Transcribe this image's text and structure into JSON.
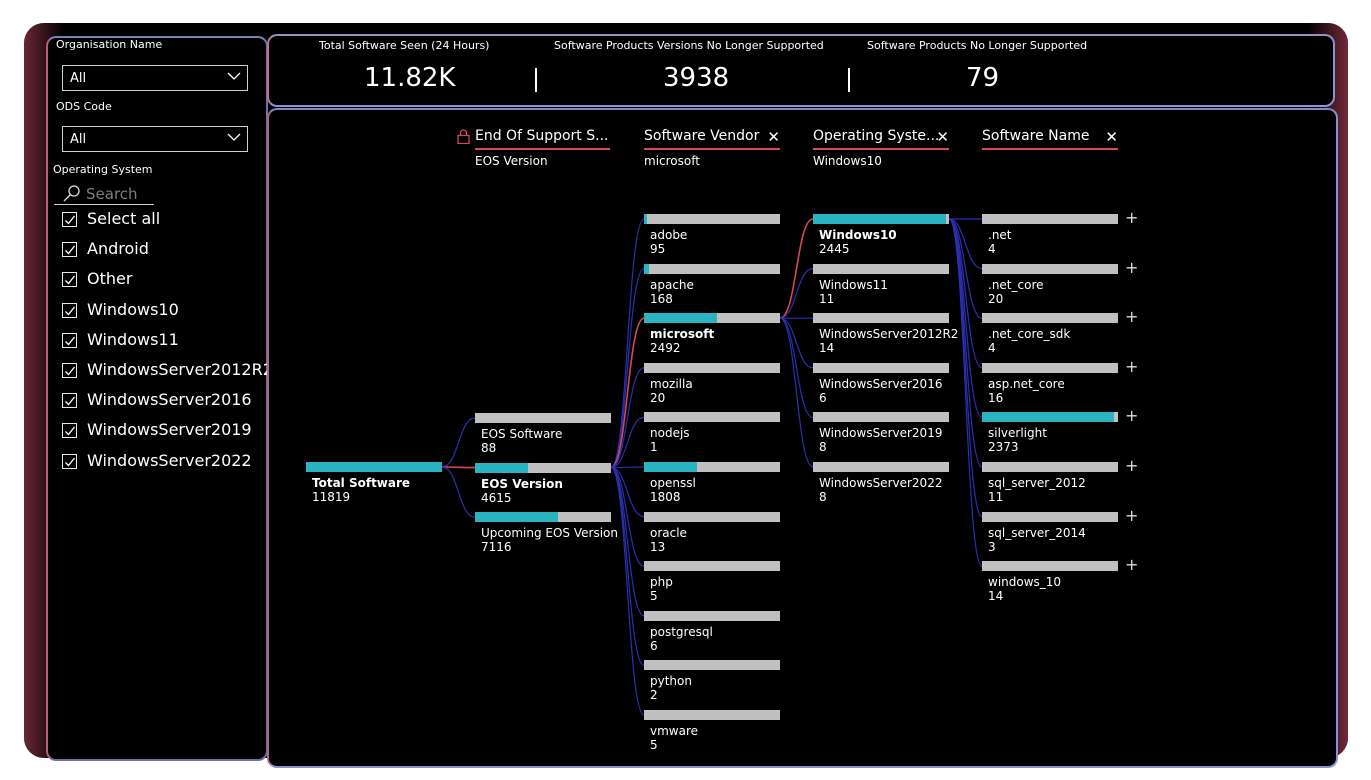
{
  "filters": {
    "org_label": "Organisation Name",
    "org_value": "All",
    "ods_label": "ODS Code",
    "ods_value": "All",
    "os_label": "Operating System",
    "search_placeholder": "Search",
    "os_options": [
      {
        "label": "Select all",
        "checked": true
      },
      {
        "label": "Android",
        "checked": true
      },
      {
        "label": "Other",
        "checked": true
      },
      {
        "label": "Windows10",
        "checked": true
      },
      {
        "label": "Windows11",
        "checked": true
      },
      {
        "label": "WindowsServer2012R2",
        "checked": true
      },
      {
        "label": "WindowsServer2016",
        "checked": true
      },
      {
        "label": "WindowsServer2019",
        "checked": true
      },
      {
        "label": "WindowsServer2022",
        "checked": true
      }
    ]
  },
  "kpis": [
    {
      "title": "Total Software Seen (24 Hours)",
      "value": "11.82K"
    },
    {
      "title": "Software Products Versions No Longer Supported",
      "value": "3938"
    },
    {
      "title": "Software Products No Longer Supported",
      "value": "79"
    }
  ],
  "tree": {
    "headers": [
      {
        "title": "End Of Support S...",
        "selected": "EOS Version",
        "locked": true
      },
      {
        "title": "Software Vendor",
        "selected": "microsoft"
      },
      {
        "title": "Operating Syste...",
        "selected": "Windows10"
      },
      {
        "title": "Software Name",
        "selected": ""
      }
    ],
    "root": {
      "name": "Total Software",
      "value": "11819",
      "fill": 1.0
    },
    "levels": [
      [
        {
          "name": "EOS Software",
          "value": "88",
          "fill": 0.0
        },
        {
          "name": "EOS Version",
          "value": "4615",
          "fill": 0.39,
          "selected": true
        },
        {
          "name": "Upcoming EOS Version",
          "value": "7116",
          "fill": 0.61
        }
      ],
      [
        {
          "name": "adobe",
          "value": "95",
          "fill": 0.02
        },
        {
          "name": "apache",
          "value": "168",
          "fill": 0.04
        },
        {
          "name": "microsoft",
          "value": "2492",
          "fill": 0.54,
          "selected": true
        },
        {
          "name": "mozilla",
          "value": "20",
          "fill": 0.0
        },
        {
          "name": "nodejs",
          "value": "1",
          "fill": 0.0
        },
        {
          "name": "openssl",
          "value": "1808",
          "fill": 0.39
        },
        {
          "name": "oracle",
          "value": "13",
          "fill": 0.0
        },
        {
          "name": "php",
          "value": "5",
          "fill": 0.0
        },
        {
          "name": "postgresql",
          "value": "6",
          "fill": 0.0
        },
        {
          "name": "python",
          "value": "2",
          "fill": 0.0
        },
        {
          "name": "vmware",
          "value": "5",
          "fill": 0.0
        }
      ],
      [
        {
          "name": "Windows10",
          "value": "2445",
          "fill": 0.98,
          "selected": true
        },
        {
          "name": "Windows11",
          "value": "11",
          "fill": 0.0
        },
        {
          "name": "WindowsServer2012R2",
          "value": "14",
          "fill": 0.0
        },
        {
          "name": "WindowsServer2016",
          "value": "6",
          "fill": 0.0
        },
        {
          "name": "WindowsServer2019",
          "value": "8",
          "fill": 0.0
        },
        {
          "name": "WindowsServer2022",
          "value": "8",
          "fill": 0.0
        }
      ],
      [
        {
          "name": ".net",
          "value": "4",
          "fill": 0.0
        },
        {
          "name": ".net_core",
          "value": "20",
          "fill": 0.0
        },
        {
          "name": ".net_core_sdk",
          "value": "4",
          "fill": 0.0
        },
        {
          "name": "asp.net_core",
          "value": "16",
          "fill": 0.0
        },
        {
          "name": "silverlight",
          "value": "2373",
          "fill": 0.97
        },
        {
          "name": "sql_server_2012",
          "value": "11",
          "fill": 0.0
        },
        {
          "name": "sql_server_2014",
          "value": "3",
          "fill": 0.0
        },
        {
          "name": "windows_10",
          "value": "14",
          "fill": 0.0
        }
      ]
    ]
  },
  "colors": {
    "accent": "#2ab3c0",
    "bar_bg": "#c0c0c0",
    "link": "#2b2fb0",
    "selected_link": "#d24a56"
  }
}
